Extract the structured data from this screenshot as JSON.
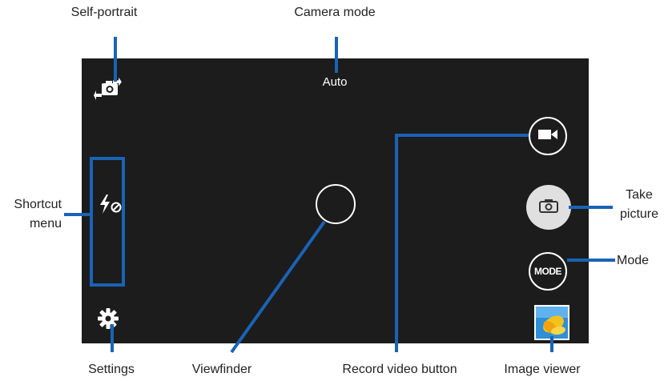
{
  "camera": {
    "mode_label": "Auto",
    "mode_button_label": "MODE"
  },
  "callouts": {
    "self_portrait": "Self-portrait",
    "camera_mode": "Camera mode",
    "shortcut_menu_line1": "Shortcut",
    "shortcut_menu_line2": "menu",
    "take_picture_line1": "Take",
    "take_picture_line2": "picture",
    "mode": "Mode",
    "settings": "Settings",
    "viewfinder": "Viewfinder",
    "record_video_button": "Record video button",
    "image_viewer": "Image viewer"
  },
  "icons": {
    "self_portrait": "camera-switch-icon",
    "flash": "flash-off-icon",
    "settings": "gear-icon",
    "record": "video-camera-icon",
    "capture": "camera-icon",
    "gallery": "gallery-thumbnail-icon"
  },
  "colors": {
    "screen_bg": "#1c1c1c",
    "callout_line": "#1a63b5",
    "capture_button": "#e0e0e0"
  }
}
